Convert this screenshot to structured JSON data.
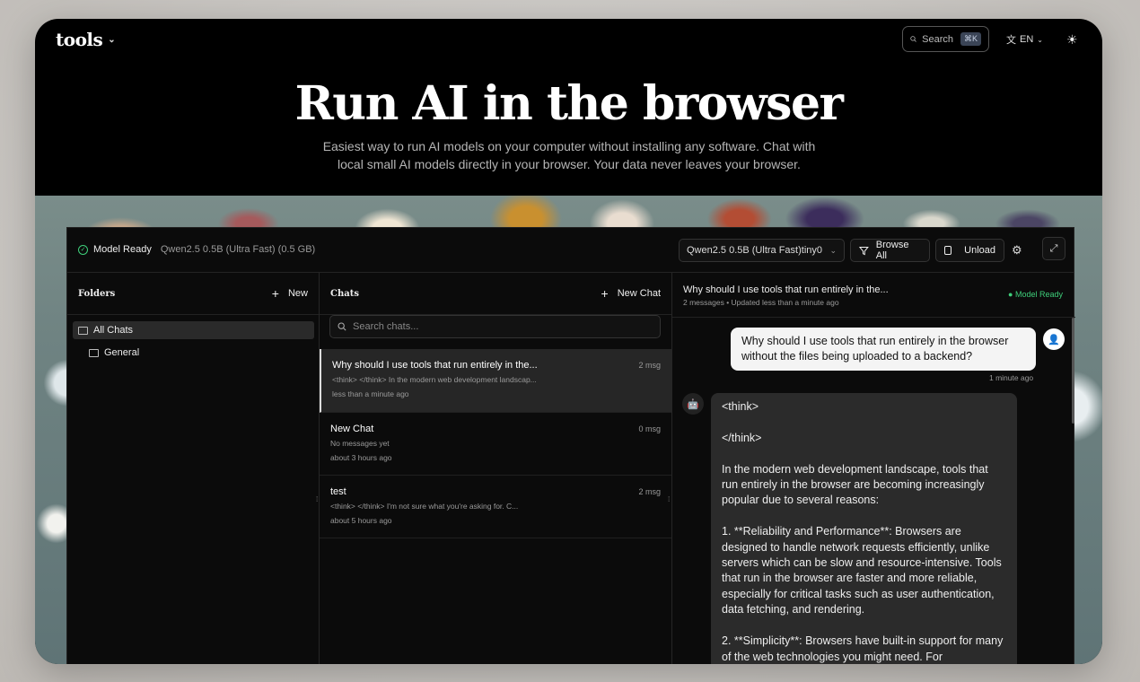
{
  "site": {
    "logo": "tools",
    "search_label": "Search",
    "search_kbd": "⌘K",
    "lang": "EN"
  },
  "hero": {
    "title": "Run AI in the browser",
    "subtitle": "Easiest way to run AI models on your computer without installing any software. Chat with local small AI models directly in your browser. Your data never leaves your browser."
  },
  "app": {
    "status_label": "Model Ready",
    "status_model": "Qwen2.5 0.5B (Ultra Fast) (0.5 GB)",
    "model_select": "Qwen2.5 0.5B (Ultra Fast)tiny0.",
    "browse_label": "Browse All",
    "unload_label": "Unload"
  },
  "folders": {
    "title": "Folders",
    "new_label": "New",
    "items": [
      {
        "label": "All Chats",
        "active": true
      },
      {
        "label": "General",
        "active": false
      }
    ]
  },
  "chats": {
    "title": "Chats",
    "new_label": "New Chat",
    "search_placeholder": "Search chats...",
    "items": [
      {
        "title": "Why should I use tools that run entirely in the...",
        "count": "2 msg",
        "preview": "<think> </think> In the modern web development landscap...",
        "time": "less than a minute ago"
      },
      {
        "title": "New Chat",
        "count": "0 msg",
        "preview": "No messages yet",
        "time": "about 3 hours ago"
      },
      {
        "title": "test",
        "count": "2 msg",
        "preview": "<think> </think> I'm not sure what you're asking for. C...",
        "time": "about 5 hours ago"
      }
    ]
  },
  "conversation": {
    "title": "Why should I use tools that run entirely in the...",
    "meta": "2 messages • Updated less than a minute ago",
    "status": "Model Ready",
    "user_message": "Why should I use tools that run entirely in the browser without the files being uploaded to a backend?",
    "user_time": "1 minute ago",
    "bot_message": "<think>\n\n</think>\n\nIn the modern web development landscape, tools that run entirely in the browser are becoming increasingly popular due to several reasons:\n\n1. **Reliability and Performance**: Browsers are designed to handle network requests efficiently, unlike servers which can be slow and resource-intensive. Tools that run in the browser are faster and more reliable, especially for critical tasks such as user authentication, data fetching, and rendering.\n\n2. **Simplicity**: Browsers have built-in support for many of the web technologies you might need. For"
  },
  "colors": {
    "accent_green": "#3ecf7a",
    "background": "#000000",
    "panel": "#0b0b0b"
  }
}
